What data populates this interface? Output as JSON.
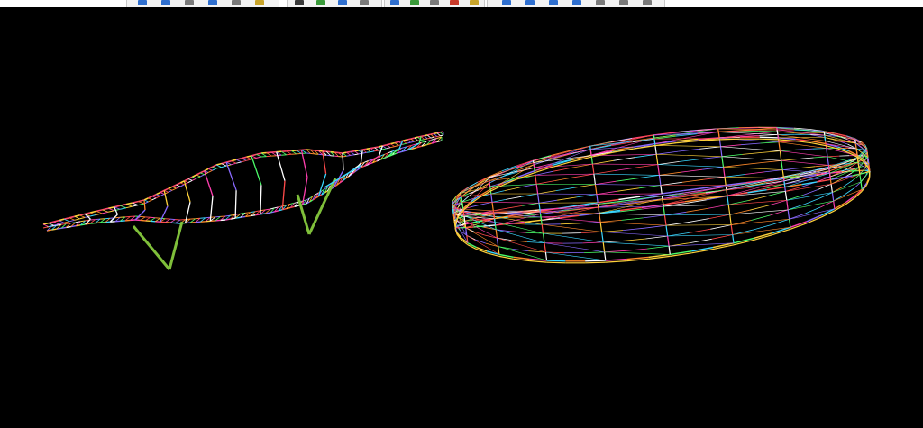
{
  "toolbar": {
    "groups": [
      {
        "name": "toolbar-group-edit",
        "buttons": [
          "undo-icon",
          "redo-icon",
          "pointer-icon",
          "rotate-icon",
          "pan-icon",
          "zoom-icon"
        ]
      },
      {
        "name": "toolbar-group-view",
        "buttons": [
          "view-front-icon",
          "view-top-icon",
          "view-side-icon",
          "view-3d-icon"
        ]
      },
      {
        "name": "toolbar-group-model",
        "buttons": [
          "node-icon",
          "member-icon",
          "support-icon",
          "load-icon",
          "section-icon"
        ]
      },
      {
        "name": "toolbar-group-nav",
        "buttons": [
          "arrow-left-icon",
          "arrow-right-icon",
          "arrow-up-icon",
          "arrow-down-icon",
          "zoom-in-icon",
          "zoom-out-icon",
          "refresh-icon"
        ]
      }
    ],
    "colors": {
      "bg": "#ffffff",
      "group_bg": "#f3f3f3",
      "border": "#c9c9c9",
      "icon_blue": "#2f6fcf",
      "icon_green": "#3a9a3a",
      "icon_red": "#c83a2a",
      "icon_gray": "#7a7a7a"
    }
  },
  "viewport": {
    "background": "#000000",
    "models": [
      {
        "name": "bridge-truss-model",
        "render": "wireframe",
        "colors": [
          "#ff4a4a",
          "#ff3fb0",
          "#ffd23a",
          "#4cff6a",
          "#3ad7ff",
          "#8a6aff",
          "#ffffff",
          "#ff8a2a"
        ],
        "support_color": "#7fbf3a",
        "support_count": 2
      },
      {
        "name": "dome-shell-model",
        "render": "wireframe",
        "colors": [
          "#ff4a4a",
          "#ff3fb0",
          "#ffd23a",
          "#4cff6a",
          "#3ad7ff",
          "#8a6aff",
          "#ffffff",
          "#ff8a2a"
        ]
      }
    ]
  }
}
